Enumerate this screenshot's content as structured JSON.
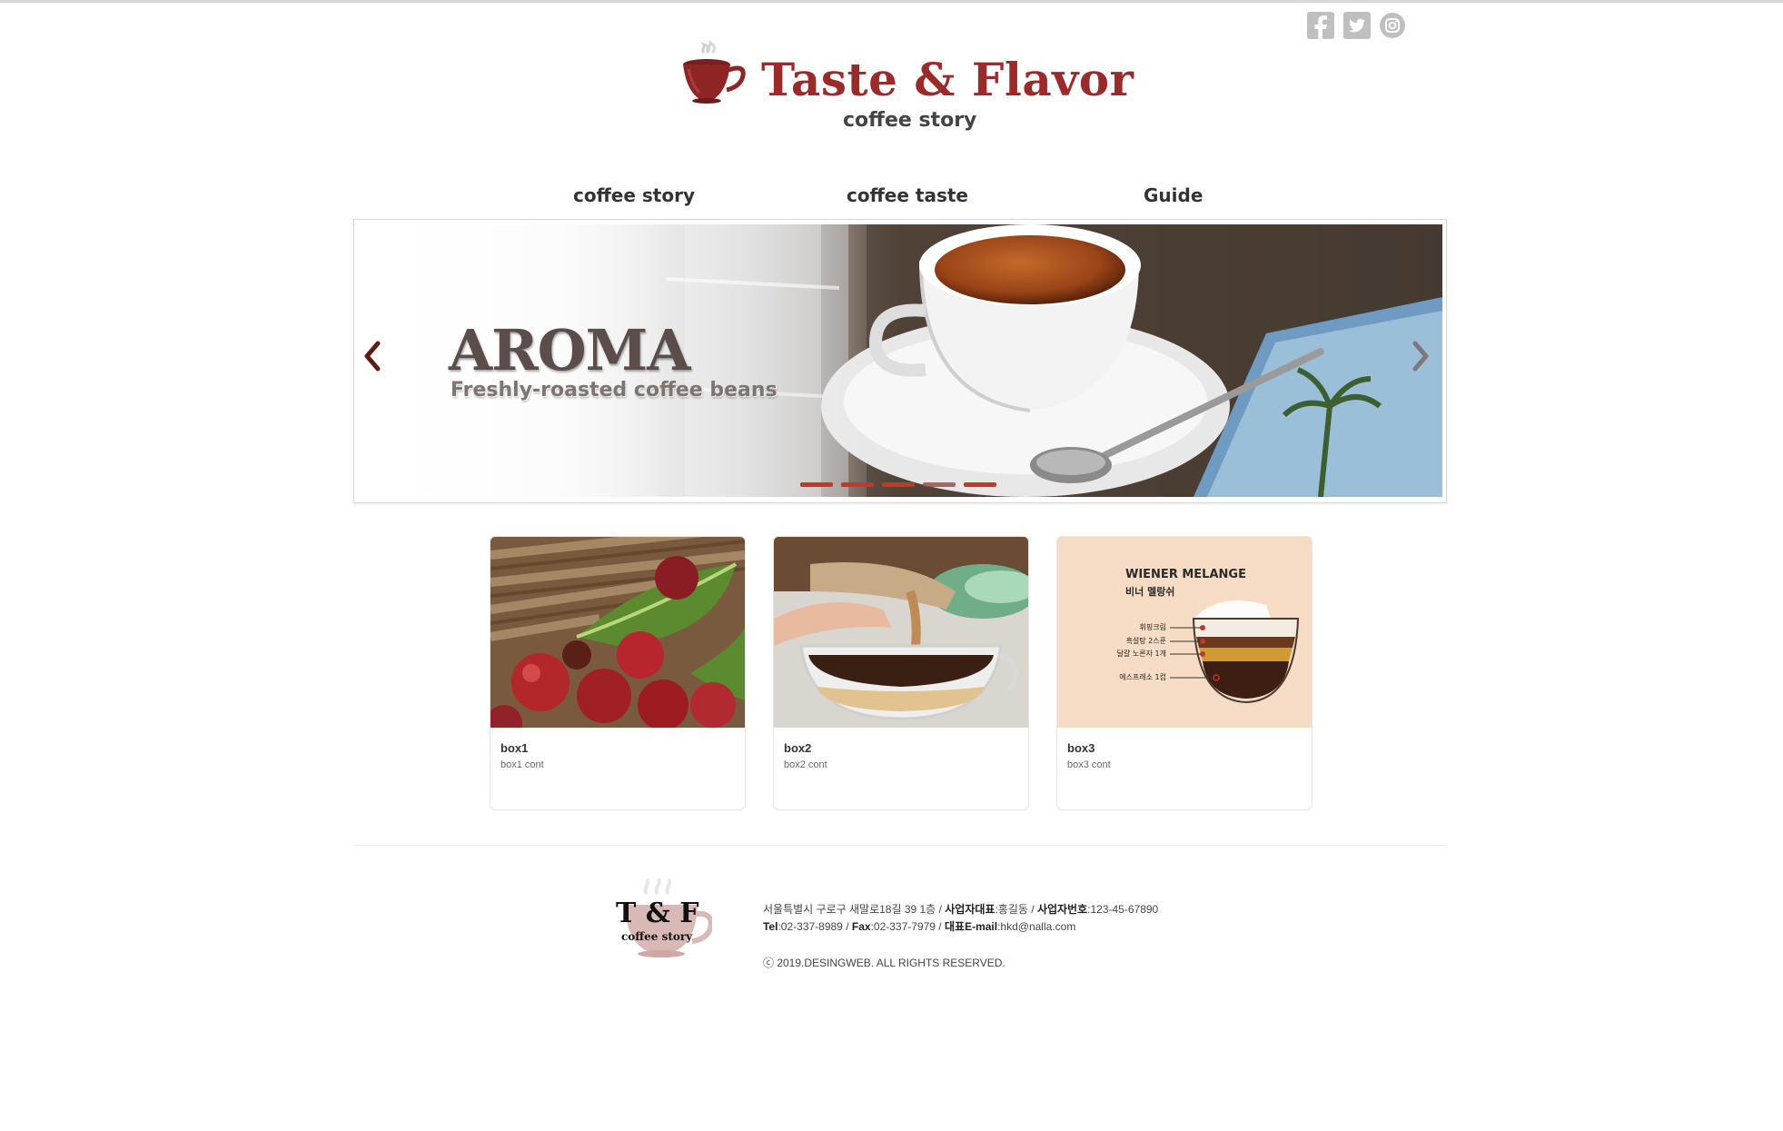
{
  "header": {
    "brand": "Taste & Flavor",
    "tagline": "coffee story",
    "social": [
      {
        "icon": "facebook-icon"
      },
      {
        "icon": "twitter-icon"
      },
      {
        "icon": "instagram-icon"
      }
    ]
  },
  "nav": {
    "items": [
      "coffee story",
      "coffee taste",
      "Guide"
    ]
  },
  "slider": {
    "title": "AROMA",
    "subtitle": "Freshly-roasted coffee beans",
    "prev_icon": "chevron-left-icon",
    "next_icon": "chevron-right-icon",
    "slide_count": 5,
    "active_index": 0
  },
  "boxes": [
    {
      "title": "box1",
      "content": "box1 cont",
      "image": "coffee cherries"
    },
    {
      "title": "box2",
      "content": "box2 cont",
      "image": "pouring coffee"
    },
    {
      "title": "box3",
      "content": "box3 cont",
      "image": "wiener melange diagram",
      "diagram": {
        "heading": "WIENER MELANGE",
        "subheading": "비너 멜랑쉬",
        "layers": [
          "휘핑크림",
          "흑설탕 2스푼",
          "달걀 노른자 1개",
          "에스프레소 1컵"
        ]
      }
    }
  ],
  "footer": {
    "logo_text": "T & F",
    "logo_sub": "coffee story",
    "address": "서울특별시 구로구 새말로18길 39 1층",
    "ceo_label": "사업자대표",
    "ceo": "홍길동",
    "bizno_label": "사업자번호",
    "bizno": "123-45-67890",
    "tel_label": "Tel",
    "tel": "02-337-8989",
    "fax_label": "Fax",
    "fax": "02-337-7979",
    "email_label": "대표E-mail",
    "email": "hkd@nalla.com",
    "copyright": "ⓒ 2019.DESINGWEB. ALL RIGHTS RESERVED."
  },
  "colors": {
    "brand": "#9b2b2b",
    "accent": "#c0392b",
    "text": "#333333"
  }
}
